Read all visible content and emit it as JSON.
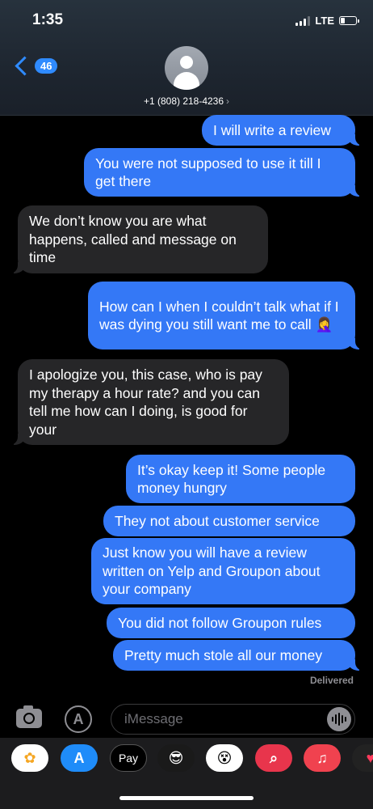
{
  "status_bar": {
    "time": "1:35",
    "network": "LTE"
  },
  "header": {
    "back_count": "46",
    "contact": "+1 (808) 218-4236",
    "contact_chevron": "›"
  },
  "messages": [
    {
      "from": "me",
      "text": "I will write a review"
    },
    {
      "from": "me",
      "text": "You were not supposed to use it till I get there"
    },
    {
      "from": "them",
      "text": "We don’t know you are what happens, called and message on time"
    },
    {
      "from": "me",
      "text": "How can I when I couldn’t talk what if I was dying you still want me to call 🤦‍♀️"
    },
    {
      "from": "them",
      "text": "I apologize you, this case, who is pay my therapy a hour rate? and you can tell me how can I doing, is good for your"
    },
    {
      "from": "me",
      "text": "It’s okay keep it! Some people money hungry"
    },
    {
      "from": "me",
      "text": "They not about customer service"
    },
    {
      "from": "me",
      "text": "Just know you will have a review written on Yelp and Groupon about your company"
    },
    {
      "from": "me",
      "text": "You did not follow Groupon rules"
    },
    {
      "from": "me",
      "text": "Pretty much stole all our money"
    }
  ],
  "delivered_label": "Delivered",
  "composer": {
    "placeholder": "iMessage"
  },
  "app_tray": {
    "items": [
      {
        "name": "photos-app-icon",
        "glyph": "✿",
        "bg": "#ffffff",
        "fg": "#f5a623"
      },
      {
        "name": "app-store-icon",
        "glyph": "A",
        "bg": "#1f8cf9",
        "fg": "#ffffff"
      },
      {
        "name": "apple-pay-icon",
        "glyph": "Pay",
        "bg": "#000000",
        "fg": "#ffffff",
        "apple": true
      },
      {
        "name": "memoji-icon",
        "glyph": "😎",
        "bg": "#1a1a1a",
        "fg": "#ffffff"
      },
      {
        "name": "animoji-icon",
        "glyph": "😵",
        "bg": "#ffffff",
        "fg": "#000000"
      },
      {
        "name": "search-web-icon",
        "glyph": "⌕",
        "bg": "#e8354c",
        "fg": "#ffffff"
      },
      {
        "name": "music-icon",
        "glyph": "♫",
        "bg": "#f0424f",
        "fg": "#ffffff"
      },
      {
        "name": "digital-touch-icon",
        "glyph": "♥",
        "bg": "#222222",
        "fg": "#ff3b5c"
      }
    ]
  }
}
